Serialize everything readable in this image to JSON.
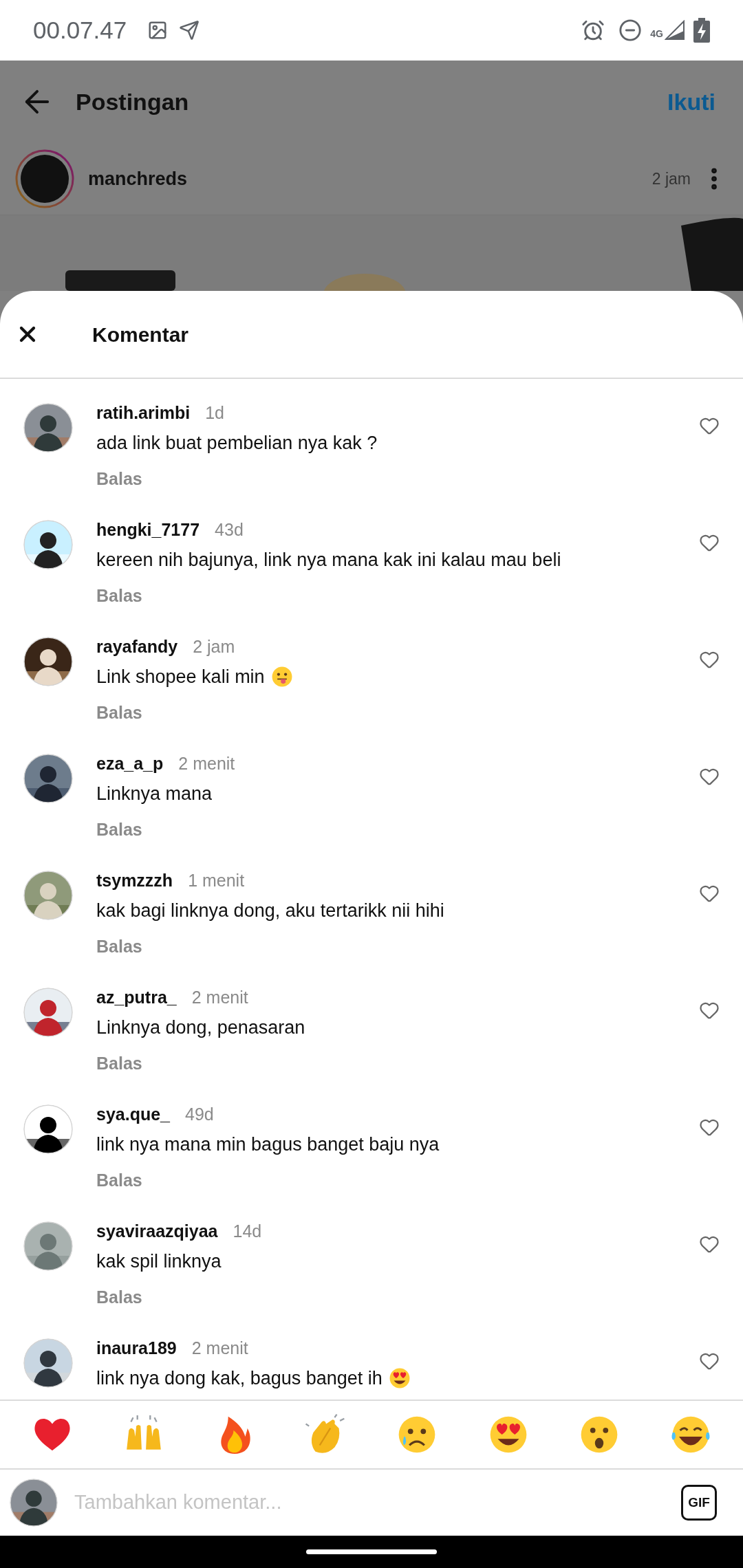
{
  "status_bar": {
    "time": "00.07.47",
    "network": "4G"
  },
  "header": {
    "title": "Postingan",
    "follow": "Ikuti"
  },
  "post": {
    "username": "manchreds",
    "time": "2 jam"
  },
  "sheet": {
    "title": "Komentar"
  },
  "comments": [
    {
      "username": "ratih.arimbi",
      "time": "1d",
      "text": "ada link buat pembelian nya kak ?",
      "reply": "Balas"
    },
    {
      "username": "hengki_7177",
      "time": "43d",
      "text": "kereen nih bajunya, link nya mana kak ini kalau mau beli",
      "reply": "Balas"
    },
    {
      "username": "rayafandy",
      "time": "2 jam",
      "text": "Link shopee kali min",
      "emoji": {
        "kind": "tongue"
      },
      "reply": "Balas"
    },
    {
      "username": "eza_a_p",
      "time": "2 menit",
      "text": "Linknya mana",
      "reply": "Balas"
    },
    {
      "username": "tsymzzzh",
      "time": "1 menit",
      "text": "kak bagi linknya dong, aku tertarikk nii hihi",
      "reply": "Balas"
    },
    {
      "username": "az_putra_",
      "time": "2 menit",
      "text": "Linknya dong, penasaran",
      "reply": "Balas"
    },
    {
      "username": "sya.que_",
      "time": "49d",
      "text": "link nya mana min bagus banget baju nya",
      "reply": "Balas"
    },
    {
      "username": "syaviraazqiyaa",
      "time": "14d",
      "text": "kak spil linknya",
      "reply": "Balas"
    },
    {
      "username": "inaura189",
      "time": "2 menit",
      "text": "link nya dong kak, bagus banget ih",
      "emoji": {
        "kind": "heart-eyes"
      }
    }
  ],
  "reactions": [
    {
      "kind": "heart"
    },
    {
      "kind": "raised-hands"
    },
    {
      "kind": "fire"
    },
    {
      "kind": "clap"
    },
    {
      "kind": "sad"
    },
    {
      "kind": "heart-eyes"
    },
    {
      "kind": "surprised"
    },
    {
      "kind": "laughing"
    }
  ],
  "composer": {
    "placeholder": "Tambahkan komentar...",
    "gif": "GIF"
  }
}
